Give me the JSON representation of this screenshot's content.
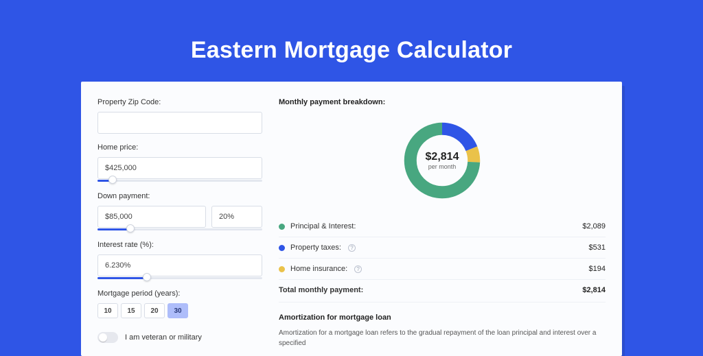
{
  "title": "Eastern Mortgage Calculator",
  "colors": {
    "principal": "#48a780",
    "taxes": "#2f55e6",
    "insurance": "#eac24a"
  },
  "form": {
    "zip": {
      "label": "Property Zip Code:",
      "value": ""
    },
    "home_price": {
      "label": "Home price:",
      "value": "$425,000",
      "slider_pct": 9
    },
    "down_payment": {
      "label": "Down payment:",
      "amount": "$85,000",
      "percent": "20%",
      "slider_pct": 20
    },
    "interest": {
      "label": "Interest rate (%):",
      "value": "6.230%",
      "slider_pct": 30
    },
    "period": {
      "label": "Mortgage period (years):",
      "options": [
        "10",
        "15",
        "20",
        "30"
      ],
      "selected": "30"
    },
    "veteran": {
      "label": "I am veteran or military",
      "on": false
    }
  },
  "breakdown": {
    "title": "Monthly payment breakdown:",
    "center_amount": "$2,814",
    "center_sub": "per month",
    "items": [
      {
        "key": "principal",
        "label": "Principal & Interest:",
        "value": "$2,089",
        "has_help": false,
        "num": 2089
      },
      {
        "key": "taxes",
        "label": "Property taxes:",
        "value": "$531",
        "has_help": true,
        "num": 531
      },
      {
        "key": "insurance",
        "label": "Home insurance:",
        "value": "$194",
        "has_help": true,
        "num": 194
      }
    ],
    "total_label": "Total monthly payment:",
    "total_value": "$2,814"
  },
  "amort": {
    "heading": "Amortization for mortgage loan",
    "body": "Amortization for a mortgage loan refers to the gradual repayment of the loan principal and interest over a specified"
  },
  "chart_data": {
    "type": "pie",
    "title": "Monthly payment breakdown",
    "series": [
      {
        "name": "Principal & Interest",
        "value": 2089,
        "color": "#48a780"
      },
      {
        "name": "Property taxes",
        "value": 531,
        "color": "#2f55e6"
      },
      {
        "name": "Home insurance",
        "value": 194,
        "color": "#eac24a"
      }
    ],
    "total": 2814,
    "center_label": "$2,814 per month"
  }
}
